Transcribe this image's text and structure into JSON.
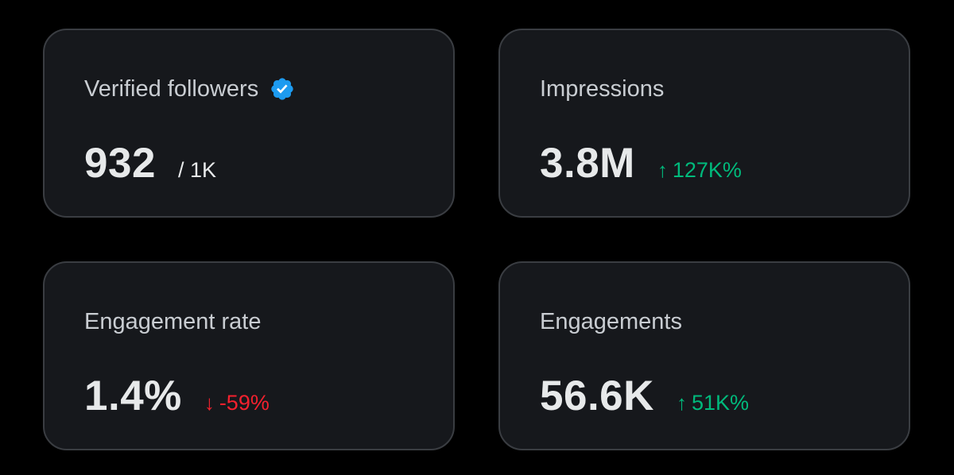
{
  "colors": {
    "background": "#000000",
    "card_background": "#16181c",
    "card_border": "#3a3d42",
    "title_text": "#c9cdd2",
    "value_text": "#e7e9ea",
    "positive": "#00ba7c",
    "negative": "#f4212e",
    "verified_badge": "#1d9bf0"
  },
  "cards": [
    {
      "title": "Verified followers",
      "icon": "verified-badge-icon",
      "value": "932",
      "sub_value": "/ 1K"
    },
    {
      "title": "Impressions",
      "value": "3.8M",
      "delta": {
        "direction": "up",
        "arrow": "↑",
        "text": "127K%"
      }
    },
    {
      "title": "Engagement rate",
      "value": "1.4%",
      "delta": {
        "direction": "down",
        "arrow": "↓",
        "text": "-59%"
      }
    },
    {
      "title": "Engagements",
      "value": "56.6K",
      "delta": {
        "direction": "up",
        "arrow": "↑",
        "text": "51K%"
      }
    }
  ]
}
